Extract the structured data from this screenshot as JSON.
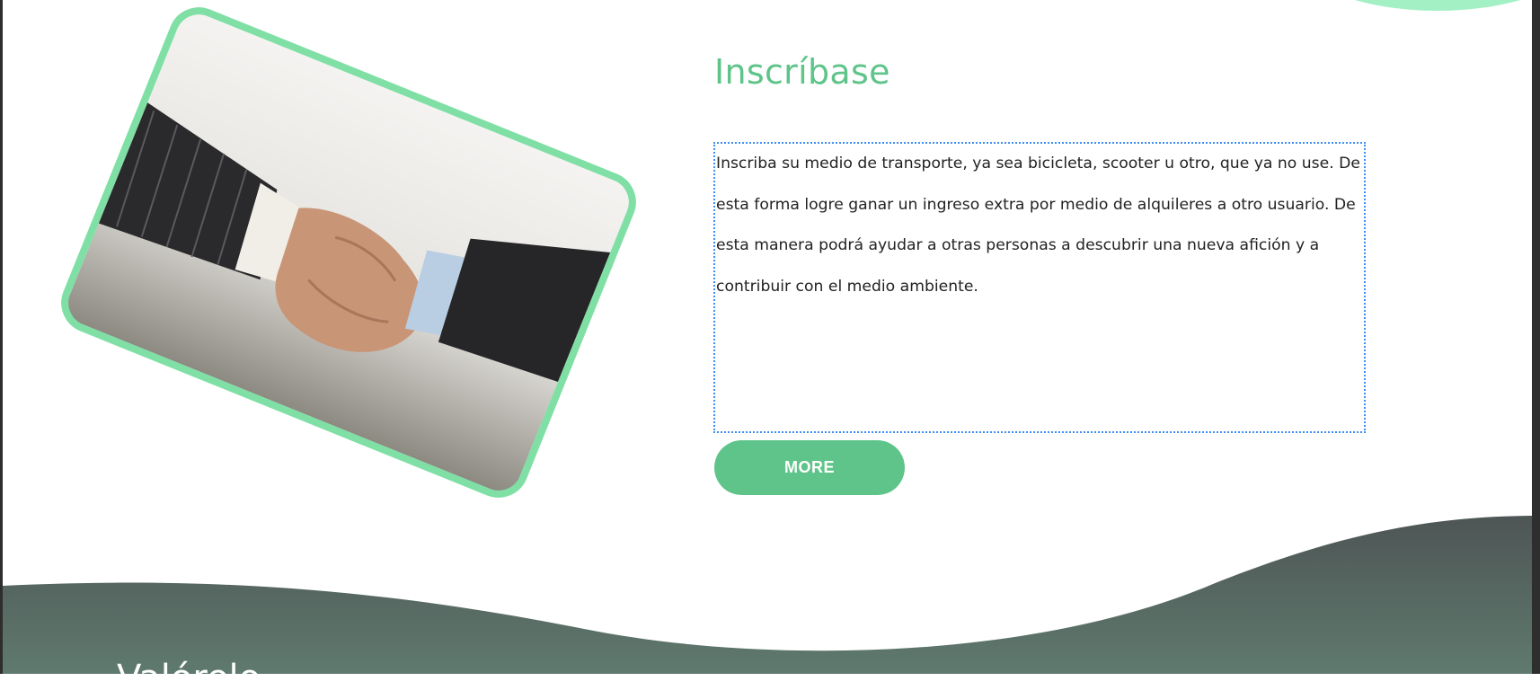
{
  "section": {
    "heading": "Inscríbase",
    "paragraph": "Inscriba su medio de transporte, ya sea bicicleta, scooter u otro, que ya no use. De esta forma logre ganar un ingreso extra por medio de alquileres a otro usuario. De esta manera podrá ayudar a otras personas a descubrir una nueva afición y a contribuir con el medio ambiente.",
    "button_label": "MORE"
  },
  "image": {
    "subject": "handshake",
    "frame_color": "#7fdfa4"
  },
  "next_section": {
    "title": "Valórelo"
  },
  "colors": {
    "accent": "#5ec489",
    "top_blob": "#a3f0c5",
    "wave_top": "#4e5555",
    "wave_bottom": "#5f7a6e",
    "selection_outline": "#3d8df5"
  }
}
